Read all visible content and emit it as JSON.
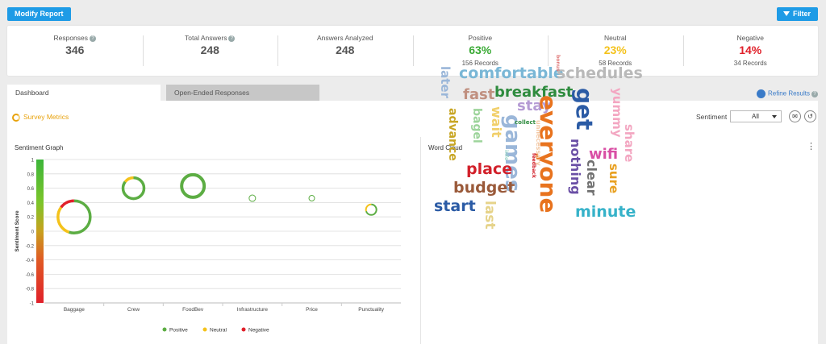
{
  "toolbar": {
    "modify_label": "Modify Report",
    "filter_label": "Filter"
  },
  "stats": [
    {
      "label": "Responses",
      "value": "346",
      "help": true
    },
    {
      "label": "Total Answers",
      "value": "248",
      "help": true
    },
    {
      "label": "Answers Analyzed",
      "value": "248"
    },
    {
      "label": "Positive",
      "value": "63%",
      "sub": "156 Records",
      "color": "#3aaa35"
    },
    {
      "label": "Neutral",
      "value": "23%",
      "sub": "58 Records",
      "color": "#f4c21b"
    },
    {
      "label": "Negative",
      "value": "14%",
      "sub": "34 Records",
      "color": "#e0202a"
    }
  ],
  "tabs": {
    "dashboard": "Dashboard",
    "open_ended": "Open-Ended Responses"
  },
  "refine": {
    "label": "Refine Results"
  },
  "help_glyph": "?",
  "metrics_label": "Survey Metrics",
  "sentiment": {
    "label": "Sentiment",
    "selected": "All"
  },
  "sentiment_graph": {
    "title": "Sentiment Graph"
  },
  "word_cloud": {
    "title": "Word Cloud",
    "more_icon": "more-vert-icon"
  },
  "colors": {
    "positive": "#5cad43",
    "neutral": "#f4c21b",
    "negative": "#e0202a",
    "accent": "#1e9be6"
  },
  "chart_data": {
    "type": "scatter",
    "title": "",
    "xlabel": "",
    "ylabel": "Sentiment Score",
    "ylim": [
      -1,
      1
    ],
    "yticks": [
      "1",
      "0.8",
      "0.6",
      "0.4",
      "0.2",
      "0",
      "-0.2",
      "-0.4",
      "-0.6",
      "-0.8",
      "-1"
    ],
    "categories": [
      "Baggage",
      "Crew",
      "FoodBev",
      "Infrastructure",
      "Price",
      "Punctuality"
    ],
    "scores": [
      0.2,
      0.6,
      0.63,
      0.46,
      0.46,
      0.3
    ],
    "mix": [
      {
        "positive": 0.55,
        "neutral": 0.3,
        "negative": 0.15
      },
      {
        "positive": 0.85,
        "neutral": 0.15,
        "negative": 0
      },
      {
        "positive": 1,
        "neutral": 0,
        "negative": 0
      },
      {
        "positive": 1,
        "neutral": 0,
        "negative": 0
      },
      {
        "positive": 1,
        "neutral": 0,
        "negative": 0
      },
      {
        "positive": 0.7,
        "neutral": 0.3,
        "negative": 0
      }
    ],
    "legend": [
      "Positive",
      "Neutral",
      "Negative"
    ],
    "legend_position": "bottom",
    "grid": true
  },
  "words": [
    {
      "text": "comfortable",
      "color": "#7ab7d6"
    },
    {
      "text": "schedules",
      "color": "#b9b9b9"
    },
    {
      "text": "later",
      "color": "#9bb7d9"
    },
    {
      "text": "fast",
      "color": "#c09080"
    },
    {
      "text": "breakfast",
      "color": "#2e8b3e"
    },
    {
      "text": "get",
      "color": "#2b5ba5"
    },
    {
      "text": "yummy",
      "color": "#f3a6c1"
    },
    {
      "text": "advance",
      "color": "#c8a624"
    },
    {
      "text": "bagel",
      "color": "#9dd49b"
    },
    {
      "text": "wait",
      "color": "#f1cf6a"
    },
    {
      "text": "stay",
      "color": "#b59bd4"
    },
    {
      "text": "games",
      "color": "#9bb7d9"
    },
    {
      "text": "everyone",
      "color": "#e8731e"
    },
    {
      "text": "share",
      "color": "#f3a6c1"
    },
    {
      "text": "nothing",
      "color": "#6a4fa5"
    },
    {
      "text": "wifi",
      "color": "#d94fa5"
    },
    {
      "text": "sure",
      "color": "#e8a020"
    },
    {
      "text": "clear",
      "color": "#707070"
    },
    {
      "text": "place",
      "color": "#d2202a"
    },
    {
      "text": "budget",
      "color": "#9a5a3a"
    },
    {
      "text": "start",
      "color": "#2b5ba5"
    },
    {
      "text": "last",
      "color": "#e6d38a"
    },
    {
      "text": "minute",
      "color": "#36b2c9"
    },
    {
      "text": "collect",
      "color": "#2e8b3e"
    },
    {
      "text": "unnecessary",
      "color": "#f3c9a6"
    },
    {
      "text": "feedback",
      "color": "#d2202a"
    },
    {
      "text": "bonus",
      "color": "#e07a7a"
    },
    {
      "text": "info",
      "color": "#9dd4c9"
    }
  ]
}
